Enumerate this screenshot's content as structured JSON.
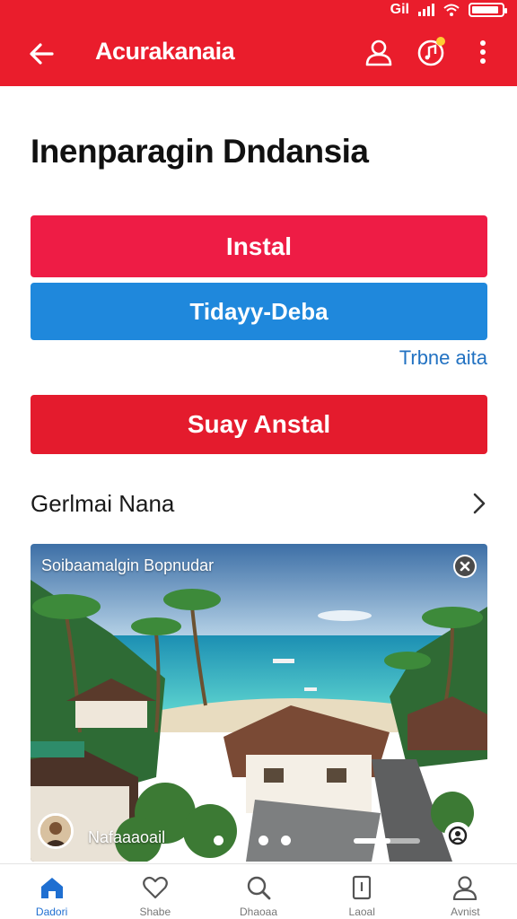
{
  "status_bar": {
    "signal_text": "Gil",
    "battery_level": 0.9
  },
  "app_bar": {
    "title": "Acurakanaia",
    "back_icon": "arrow-left-icon",
    "actions": [
      "user-icon",
      "music-badge-icon",
      "more-vert-icon"
    ]
  },
  "main": {
    "title": "Inenparagin Dndansia",
    "install_label": "Instal",
    "today_label": "Tidayy-Deba",
    "link_label": "Trbne aita",
    "stay_label": "Suay Anstal",
    "section_label": "Gerlmai Nana"
  },
  "card": {
    "caption": "Soibaamalgin Bopnudar",
    "author": "Nafaaaoail",
    "slide_count": 4,
    "progress": 0.55
  },
  "bottom_nav": {
    "items": [
      {
        "label": "Dadori",
        "icon": "home-icon"
      },
      {
        "label": "Shabe",
        "icon": "heart-icon"
      },
      {
        "label": "Dhaoaa",
        "icon": "search-icon"
      },
      {
        "label": "Laoal",
        "icon": "bookmark-icon"
      },
      {
        "label": "Avnist",
        "icon": "user-icon"
      }
    ]
  },
  "colors": {
    "brand_red": "#ea1d2c",
    "install_red": "#ee1c45",
    "today_blue": "#1f88dc",
    "link_blue": "#2272c2",
    "active_blue": "#1f6fd1"
  }
}
